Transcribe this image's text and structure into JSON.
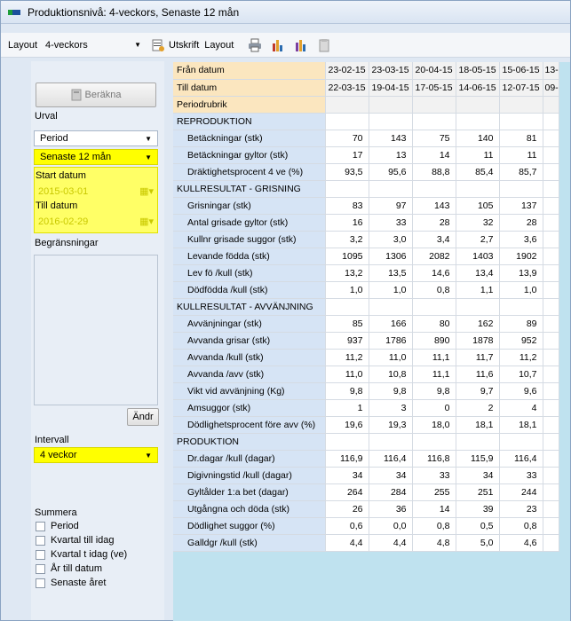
{
  "window": {
    "title": "Produktionsnivå: 4-veckors, Senaste 12 mån"
  },
  "toolbar": {
    "layout_label": "Layout",
    "layout_value": "4-veckors",
    "print_label": "Utskrift",
    "layout_button": "Layout"
  },
  "left": {
    "calc_button": "Beräkna",
    "urval_label": "Urval",
    "period_select": "Period",
    "period_value": "Senaste 12 mån",
    "start_label": "Start datum",
    "start_value": "2015-03-01",
    "end_label": "Till datum",
    "end_value": "2016-02-29",
    "limits_label": "Begränsningar",
    "change_button": "Ändr",
    "interval_label": "Intervall",
    "interval_value": "4 veckor",
    "sum_label": "Summera",
    "sum_options": [
      "Period",
      "Kvartal till idag",
      "Kvartal t idag (ve)",
      "År till datum",
      "Senaste året"
    ]
  },
  "grid": {
    "header_rows": [
      {
        "label": "Från datum",
        "values": [
          "23-02-15",
          "23-03-15",
          "20-04-15",
          "18-05-15",
          "15-06-15",
          "13-"
        ]
      },
      {
        "label": "Till datum",
        "values": [
          "22-03-15",
          "19-04-15",
          "17-05-15",
          "14-06-15",
          "12-07-15",
          "09-"
        ]
      },
      {
        "label": "Periodrubrik",
        "values": [
          "",
          "",
          "",
          "",
          "",
          ""
        ]
      }
    ],
    "rows": [
      {
        "label": "REPRODUKTION",
        "section": true,
        "values": [
          "",
          "",
          "",
          "",
          "",
          ""
        ]
      },
      {
        "label": "Betäckningar (stk)",
        "values": [
          "70",
          "143",
          "75",
          "140",
          "81",
          ""
        ]
      },
      {
        "label": "Betäckningar gyltor (stk)",
        "values": [
          "17",
          "13",
          "14",
          "11",
          "11",
          ""
        ]
      },
      {
        "label": "Dräktighetsprocent 4 ve (%)",
        "values": [
          "93,5",
          "95,6",
          "88,8",
          "85,4",
          "85,7",
          ""
        ]
      },
      {
        "label": "KULLRESULTAT - GRISNING",
        "section": true,
        "values": [
          "",
          "",
          "",
          "",
          "",
          ""
        ]
      },
      {
        "label": "Grisningar (stk)",
        "values": [
          "83",
          "97",
          "143",
          "105",
          "137",
          ""
        ]
      },
      {
        "label": "Antal grisade gyltor (stk)",
        "values": [
          "16",
          "33",
          "28",
          "32",
          "28",
          ""
        ]
      },
      {
        "label": "Kullnr grisade suggor (stk)",
        "values": [
          "3,2",
          "3,0",
          "3,4",
          "2,7",
          "3,6",
          ""
        ]
      },
      {
        "label": "Levande födda (stk)",
        "values": [
          "1095",
          "1306",
          "2082",
          "1403",
          "1902",
          ""
        ]
      },
      {
        "label": "Lev fö /kull (stk)",
        "values": [
          "13,2",
          "13,5",
          "14,6",
          "13,4",
          "13,9",
          ""
        ]
      },
      {
        "label": "Dödfödda /kull (stk)",
        "values": [
          "1,0",
          "1,0",
          "0,8",
          "1,1",
          "1,0",
          ""
        ]
      },
      {
        "label": "KULLRESULTAT - AVVÄNJNING",
        "section": true,
        "values": [
          "",
          "",
          "",
          "",
          "",
          ""
        ]
      },
      {
        "label": "Avvänjningar (stk)",
        "values": [
          "85",
          "166",
          "80",
          "162",
          "89",
          ""
        ]
      },
      {
        "label": "Avvanda grisar (stk)",
        "values": [
          "937",
          "1786",
          "890",
          "1878",
          "952",
          ""
        ]
      },
      {
        "label": "Avvanda /kull (stk)",
        "values": [
          "11,2",
          "11,0",
          "11,1",
          "11,7",
          "11,2",
          ""
        ]
      },
      {
        "label": "Avvanda /avv (stk)",
        "values": [
          "11,0",
          "10,8",
          "11,1",
          "11,6",
          "10,7",
          ""
        ]
      },
      {
        "label": "Vikt vid avvänjning (Kg)",
        "values": [
          "9,8",
          "9,8",
          "9,8",
          "9,7",
          "9,6",
          ""
        ]
      },
      {
        "label": "Amsuggor (stk)",
        "values": [
          "1",
          "3",
          "0",
          "2",
          "4",
          ""
        ]
      },
      {
        "label": "Dödlighetsprocent före avv (%)",
        "values": [
          "19,6",
          "19,3",
          "18,0",
          "18,1",
          "18,1",
          ""
        ]
      },
      {
        "label": "PRODUKTION",
        "section": true,
        "values": [
          "",
          "",
          "",
          "",
          "",
          ""
        ]
      },
      {
        "label": "Dr.dagar /kull (dagar)",
        "values": [
          "116,9",
          "116,4",
          "116,8",
          "115,9",
          "116,4",
          ""
        ]
      },
      {
        "label": "Digivningstid /kull (dagar)",
        "values": [
          "34",
          "34",
          "33",
          "34",
          "33",
          ""
        ]
      },
      {
        "label": "Gyltålder 1:a bet (dagar)",
        "values": [
          "264",
          "284",
          "255",
          "251",
          "244",
          ""
        ]
      },
      {
        "label": "Utgångna och döda (stk)",
        "values": [
          "26",
          "36",
          "14",
          "39",
          "23",
          ""
        ]
      },
      {
        "label": "Dödlighet suggor (%)",
        "values": [
          "0,6",
          "0,0",
          "0,8",
          "0,5",
          "0,8",
          ""
        ]
      },
      {
        "label": "Galldgr /kull (stk)",
        "values": [
          "4,4",
          "4,4",
          "4,8",
          "5,0",
          "4,6",
          ""
        ]
      }
    ]
  },
  "colors": {
    "highlight": "#ffff00",
    "label_bg": "#d6e4f5",
    "header_bg": "#fbe6bf",
    "empty_bg": "#bfe2ef"
  }
}
